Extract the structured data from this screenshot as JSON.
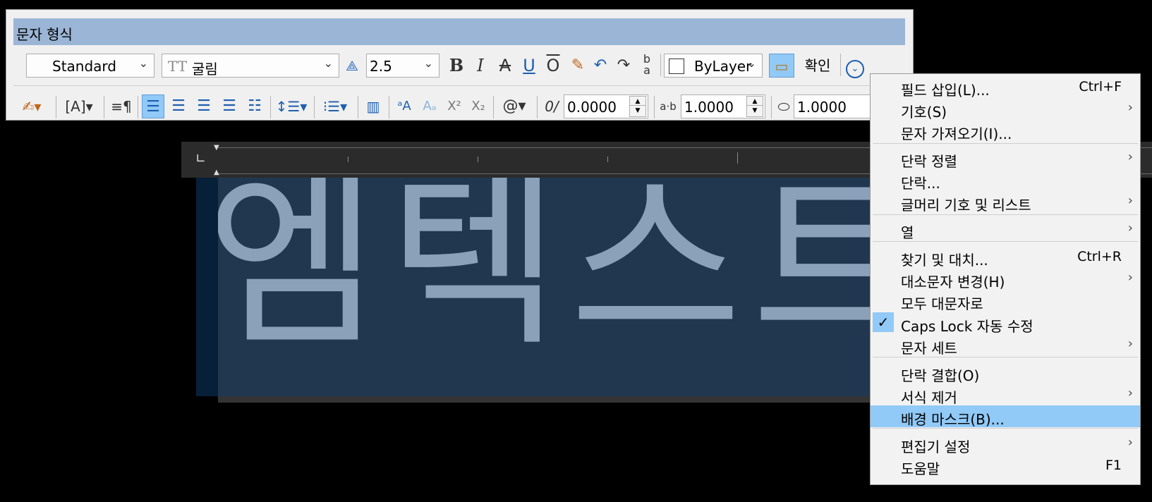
{
  "toolbar": {
    "title": "문자 형식",
    "style_value": "Standard",
    "font_prefix": "TT",
    "font_value": "굴림",
    "height_value": "2.5",
    "bold": "B",
    "italic": "I",
    "strike": "A",
    "underline": "U",
    "overline": "O",
    "color_value": "ByLayer",
    "ok_label": "확인",
    "oblique_value": "0.0000",
    "tracking_value": "1.0000",
    "width_value": "1.0000",
    "superscript": "X²",
    "subscript": "X₂",
    "symbol": "@"
  },
  "editor": {
    "text": "엠텍스트"
  },
  "menu": {
    "items": [
      {
        "label": "필드 삽입(L)...",
        "shortcut": "Ctrl+F",
        "submenu": false
      },
      {
        "label": "기호(S)",
        "shortcut": "",
        "submenu": true
      },
      {
        "label": "문자 가져오기(I)...",
        "shortcut": "",
        "submenu": false
      },
      {
        "label": "단락 정렬",
        "shortcut": "",
        "submenu": true
      },
      {
        "label": "단락...",
        "shortcut": "",
        "submenu": false
      },
      {
        "label": "글머리 기호 및 리스트",
        "shortcut": "",
        "submenu": true
      },
      {
        "label": "열",
        "shortcut": "",
        "submenu": true
      },
      {
        "label": "찾기 및 대치...",
        "shortcut": "Ctrl+R",
        "submenu": false
      },
      {
        "label": "대소문자 변경(H)",
        "shortcut": "",
        "submenu": true
      },
      {
        "label": "모두 대문자로",
        "shortcut": "",
        "submenu": false
      },
      {
        "label": "Caps Lock 자동 수정",
        "shortcut": "",
        "submenu": false,
        "checked": true
      },
      {
        "label": "문자 세트",
        "shortcut": "",
        "submenu": true
      },
      {
        "label": "단락 결합(O)",
        "shortcut": "",
        "submenu": false
      },
      {
        "label": "서식 제거",
        "shortcut": "",
        "submenu": true
      },
      {
        "label": "배경 마스크(B)...",
        "shortcut": "",
        "submenu": false,
        "highlighted": true
      },
      {
        "label": "편집기 설정",
        "shortcut": "",
        "submenu": true
      },
      {
        "label": "도움말",
        "shortcut": "F1",
        "submenu": false
      }
    ]
  },
  "colors": {
    "title_bar": "#9bb5d6",
    "text_bg": "#213750",
    "text_color": "#8aa1b9",
    "menu_highlight": "#91c9f7"
  }
}
